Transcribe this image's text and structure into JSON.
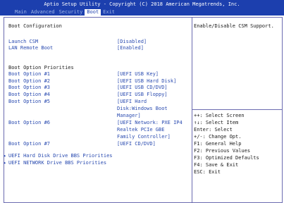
{
  "header": {
    "title": "Aptio Setup Utility - Copyright (C) 2018 American Megatrends, Inc.",
    "tabs": [
      "Main",
      "Advanced",
      "Security",
      "Boot",
      "Exit"
    ],
    "active_tab": "Boot"
  },
  "main": {
    "section_title": "Boot Configuration",
    "launch_csm": {
      "label": "Launch CSM",
      "value": "[Disabled]"
    },
    "lan_remote_boot": {
      "label": "LAN Remote Boot",
      "value": "[Enabled]"
    },
    "priorities_title": "Boot Option Priorities",
    "boot_options": [
      {
        "label": "Boot Option #1",
        "value_lines": [
          "[UEFI USB Key]"
        ]
      },
      {
        "label": "Boot Option #2",
        "value_lines": [
          "[UEFI USB Hard Disk]"
        ]
      },
      {
        "label": "Boot Option #3",
        "value_lines": [
          "[UEFI USB CD/DVD]"
        ]
      },
      {
        "label": "Boot Option #4",
        "value_lines": [
          "[UEFI USB Floppy]"
        ]
      },
      {
        "label": "Boot Option #5",
        "value_lines": [
          "[UEFI Hard",
          "Disk:Windows Boot",
          "Manager]"
        ]
      },
      {
        "label": "Boot Option #6",
        "value_lines": [
          "[UEFI Network: PXE IP4",
          "Realtek PCIe GBE",
          "Family Controller]"
        ]
      },
      {
        "label": "Boot Option #7",
        "value_lines": [
          "[UEFI CD/DVD]"
        ]
      }
    ],
    "submenus": [
      "UEFI Hard Disk Drive BBS Priorities",
      "UEFI NETWORK Drive BBS Priorities"
    ]
  },
  "help": {
    "description": "Enable/Disable CSM Support.",
    "keys": [
      "++: Select Screen",
      "↑↓: Select Item",
      "Enter: Select",
      "+/-: Change Opt.",
      "F1: General Help",
      "F2: Previous Values",
      "F3: Optimized Defaults",
      "F4: Save & Exit",
      "ESC: Exit"
    ]
  },
  "colors": {
    "header_bg": "#1c3fae",
    "label_blue": "#2a4bb0"
  }
}
